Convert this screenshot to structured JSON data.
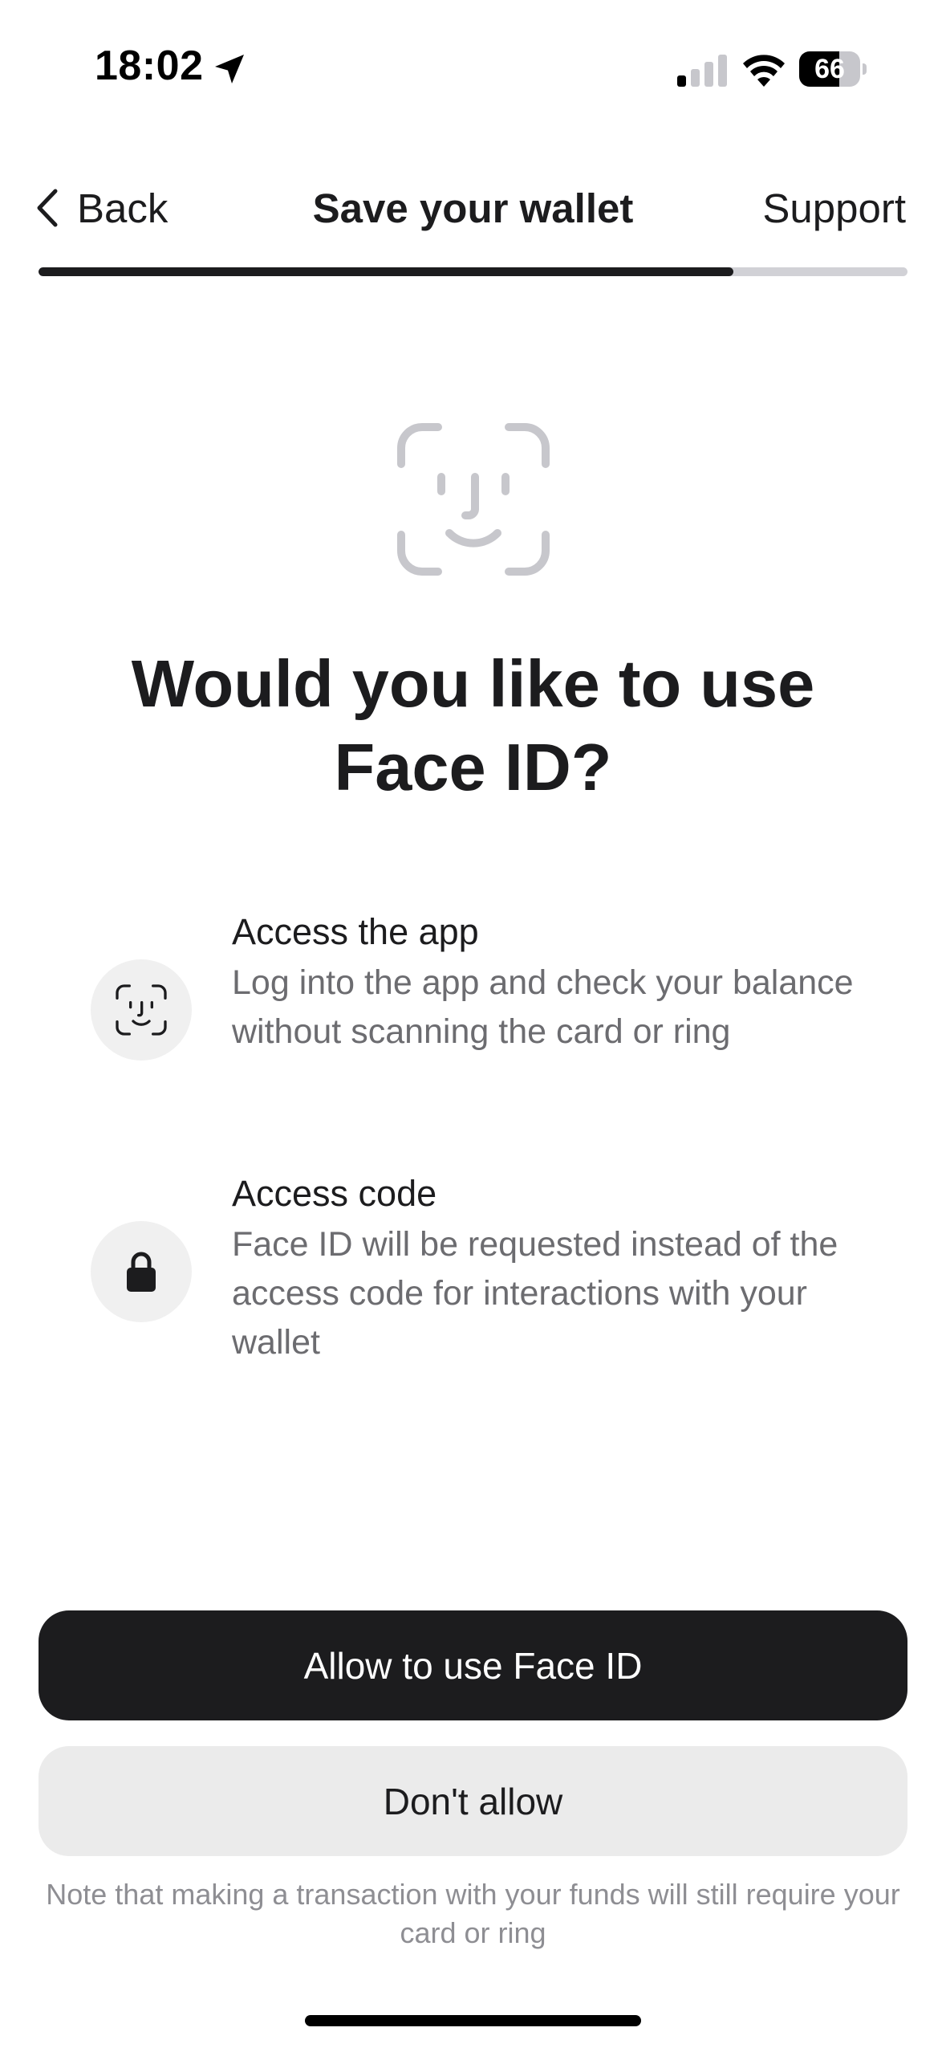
{
  "status_bar": {
    "time": "18:02",
    "battery_percent": 66,
    "battery_label": "66",
    "signal_bars_active": 1,
    "signal_bars_total": 4,
    "icons": [
      "location-arrow-icon",
      "cellular-signal-icon",
      "wifi-icon",
      "battery-icon"
    ]
  },
  "nav": {
    "back_label": "Back",
    "title": "Save your wallet",
    "support_label": "Support"
  },
  "progress": {
    "fraction": 0.8
  },
  "hero": {
    "icon": "face-id-icon",
    "headline": "Would you like to use Face ID?"
  },
  "features": [
    {
      "icon": "face-id-icon",
      "title": "Access the app",
      "description": "Log into the app and check your balance without scanning the card or ring"
    },
    {
      "icon": "lock-icon",
      "title": "Access code",
      "description": "Face ID will be requested instead of the access code for interactions with your wallet"
    }
  ],
  "actions": {
    "primary_label": "Allow to use Face ID",
    "secondary_label": "Don't allow"
  },
  "footnote": "Note that making a transaction with your funds will still require your card or ring",
  "colors": {
    "primary_button": "#1c1c1e",
    "secondary_button": "#ebebeb",
    "progress_fill": "#1c1c1e",
    "progress_track": "#d1d1d6",
    "icon_gray": "#c7c7cc"
  }
}
